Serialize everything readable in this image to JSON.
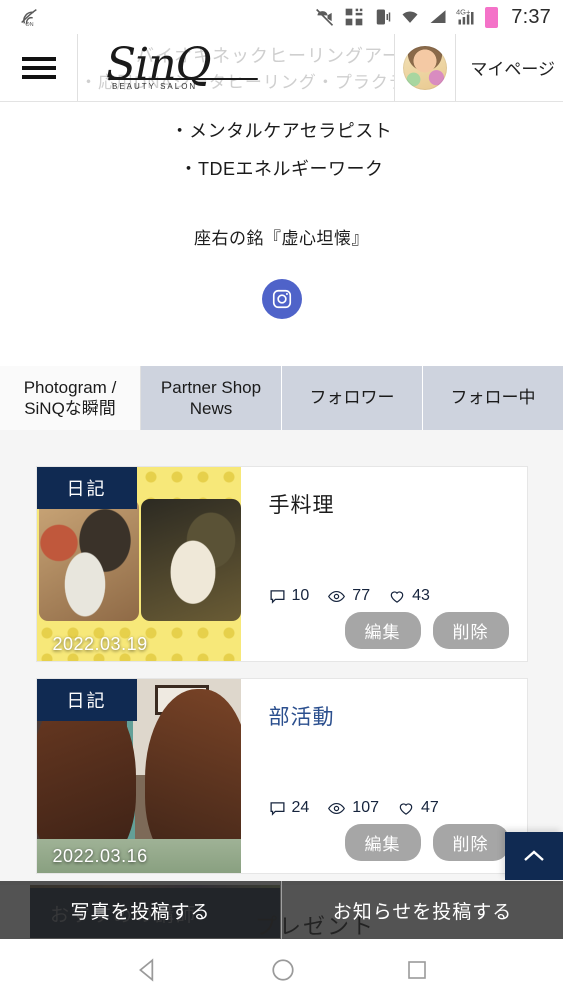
{
  "status_bar": {
    "clock": "7:37",
    "network_label": "4G+",
    "icons": [
      "nfc-on-icon",
      "call-mute-icon",
      "qr-scan-icon",
      "vibrate-icon",
      "wifi-icon",
      "signal-triangle-icon",
      "signal-bars-icon",
      "battery-icon"
    ]
  },
  "header": {
    "menu_label": "menu",
    "logo_text": "SinQ",
    "logo_sub": "BEAUTY SALON",
    "ghost_line1": "バイオキネックヒーリングアーティスト",
    "ghost_line2": "・応用DNAシータヒーリング・プラクティショナー",
    "mypage_label": "マイページ",
    "avatar_alt": "user-avatar"
  },
  "profile": {
    "lines": [
      "・メンタルケアセラピスト",
      "・TDEエネルギーワーク"
    ],
    "motto": "座右の銘『虚心坦懐』",
    "instagram_label": "instagram",
    "instagram_color": "#4f63c9"
  },
  "tabs": [
    {
      "label": "Photogram / SiNQな瞬間",
      "active": true
    },
    {
      "label": "Partner Shop News",
      "active": false
    },
    {
      "label": "フォロワー",
      "active": false
    },
    {
      "label": "フォロー中",
      "active": false
    }
  ],
  "feed": {
    "posts": [
      {
        "badge": "日記",
        "date": "2022.03.19",
        "title": "手料理",
        "title_is_link": false,
        "comments": "10",
        "views": "77",
        "likes": "43",
        "edit_label": "編集",
        "delete_label": "削除"
      },
      {
        "badge": "日記",
        "date": "2022.03.16",
        "title": "部活動",
        "title_is_link": true,
        "comments": "24",
        "views": "107",
        "likes": "47",
        "edit_label": "編集",
        "delete_label": "削除"
      }
    ]
  },
  "teaser": {
    "recommend_label": "おすすめの講師",
    "present_label": "プレゼント"
  },
  "post_bar": {
    "photo_label": "写真を投稿する",
    "news_label": "お知らせを投稿する"
  },
  "scroll_top": {
    "label": "scroll-to-top",
    "color": "#102a52"
  },
  "android_nav": {
    "back_label": "back",
    "home_label": "home",
    "recents_label": "recents"
  },
  "colors": {
    "brand_navy": "#102a52",
    "page_bg": "#f5f5f5",
    "tab_inactive": "#ced3de",
    "pill_gray": "#a6a6a6",
    "link_blue": "#2b4f8e"
  }
}
